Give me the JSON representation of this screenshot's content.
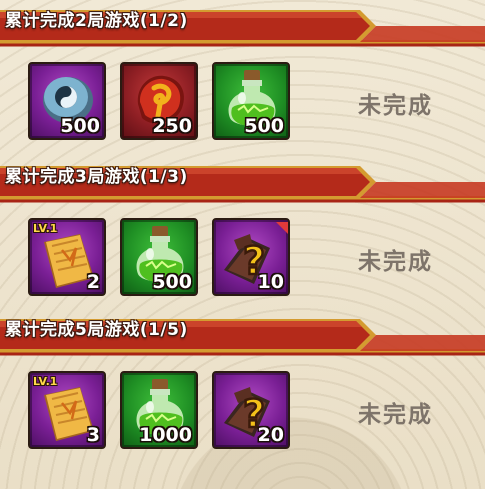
{
  "tasks": [
    {
      "title": "累计完成2局游戏(1/2)",
      "status": "未完成",
      "rewards": [
        {
          "icon": "taiji-gem-icon",
          "frame": "purple",
          "qty": "500"
        },
        {
          "icon": "red-rune-stone-icon",
          "frame": "red",
          "qty": "250"
        },
        {
          "icon": "green-potion-icon",
          "frame": "green",
          "qty": "500"
        }
      ]
    },
    {
      "title": "累计完成3局游戏(1/3)",
      "status": "未完成",
      "rewards": [
        {
          "icon": "scroll-card-icon",
          "frame": "purple",
          "level": "LV.1",
          "qty": "2"
        },
        {
          "icon": "green-potion-icon",
          "frame": "green",
          "qty": "500"
        },
        {
          "icon": "mystery-item-icon",
          "frame": "purple",
          "qty": "10"
        }
      ]
    },
    {
      "title": "累计完成5局游戏(1/5)",
      "status": "未完成",
      "rewards": [
        {
          "icon": "scroll-card-icon",
          "frame": "purple",
          "level": "LV.1",
          "qty": "3"
        },
        {
          "icon": "green-potion-icon",
          "frame": "green",
          "qty": "1000"
        },
        {
          "icon": "mystery-item-icon",
          "frame": "purple",
          "qty": "20"
        }
      ]
    }
  ],
  "colors": {
    "banner_red": "#b42a1a",
    "banner_gold": "#d9a23a",
    "status_gray": "#7e746a"
  }
}
